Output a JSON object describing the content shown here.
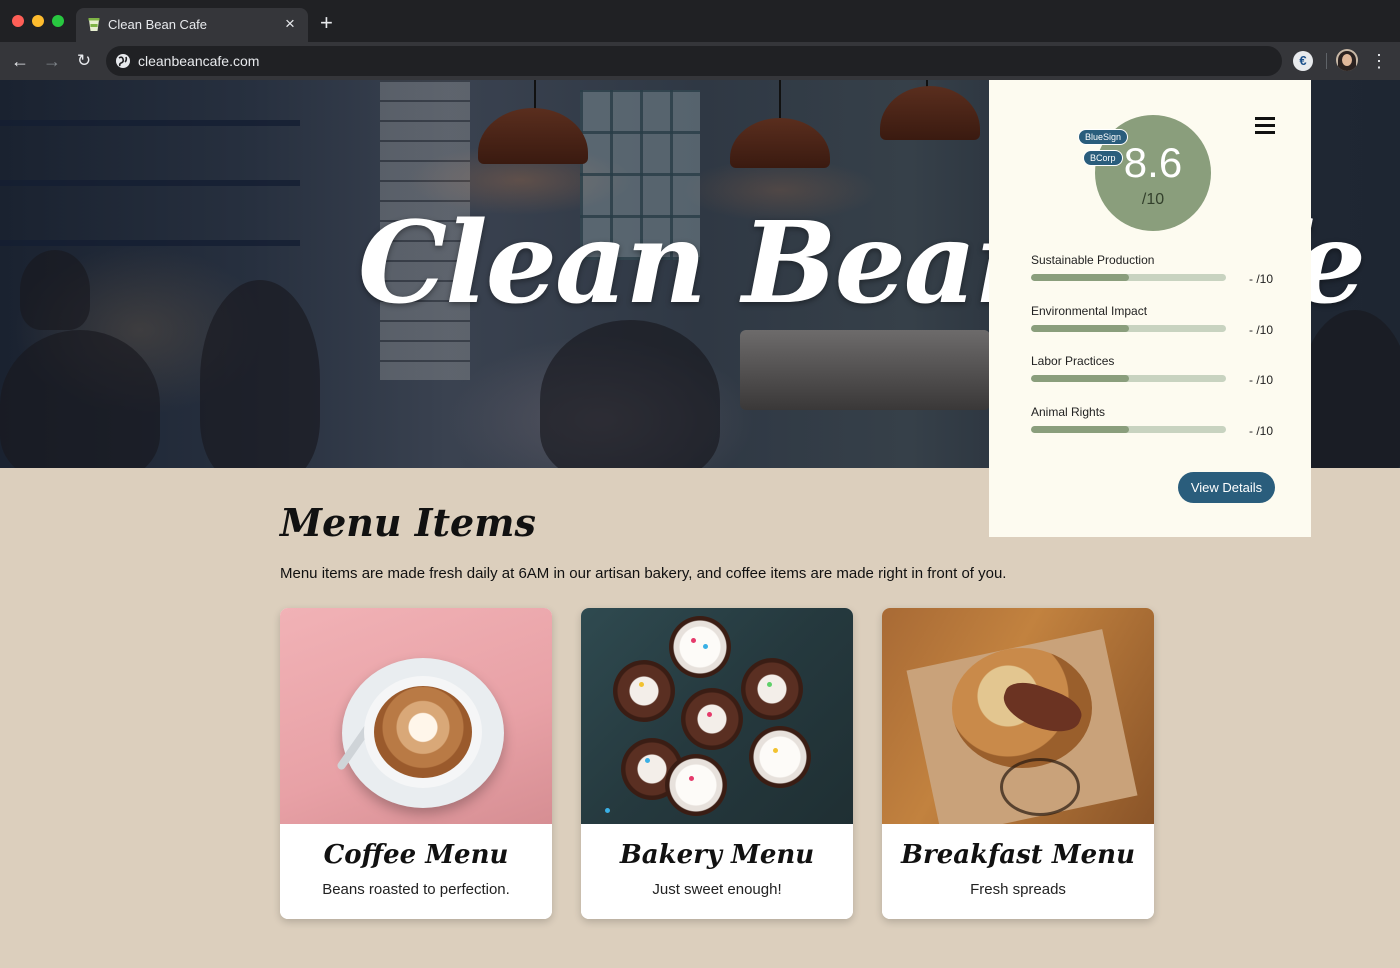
{
  "browser": {
    "tab_title": "Clean Bean Cafe",
    "tab_close": "×",
    "new_tab": "+",
    "url": "cleanbeancafe.com",
    "back": "←",
    "forward": "→",
    "reload": "↻",
    "menu": "⋮",
    "extension_label": "€"
  },
  "hero": {
    "title": "Clean Bean Cafe"
  },
  "rating": {
    "score": "8.6",
    "denominator": "/10",
    "badges": [
      "BlueSign",
      "BCorp"
    ],
    "metrics": [
      {
        "label": "Sustainable Production",
        "score": "- /10",
        "fill": 0.5
      },
      {
        "label": "Environmental Impact",
        "score": "- /10",
        "fill": 0.5
      },
      {
        "label": "Labor Practices",
        "score": "- /10",
        "fill": 0.5
      },
      {
        "label": "Animal Rights",
        "score": "- /10",
        "fill": 0.5
      }
    ],
    "details_button": "View Details",
    "colors": {
      "panel": "#fdfbf0",
      "accent_green": "#8a9e7c",
      "button_blue": "#2a5d7c"
    }
  },
  "menu": {
    "heading": "Menu Items",
    "intro": "Menu items are made fresh daily at 6AM in our artisan bakery, and coffee items are made right in front of you.",
    "cards": [
      {
        "title": "Coffee Menu",
        "subtitle": "Beans roasted to perfection.",
        "image": "latte-art-photo"
      },
      {
        "title": "Bakery Menu",
        "subtitle": "Just sweet enough!",
        "image": "cupcakes-photo"
      },
      {
        "title": "Breakfast Menu",
        "subtitle": "Fresh spreads",
        "image": "bagel-sandwich-photo"
      }
    ]
  },
  "colors": {
    "page_background": "#dccfbd",
    "chrome_dark": "#202124",
    "chrome_toolbar": "#35363a"
  }
}
